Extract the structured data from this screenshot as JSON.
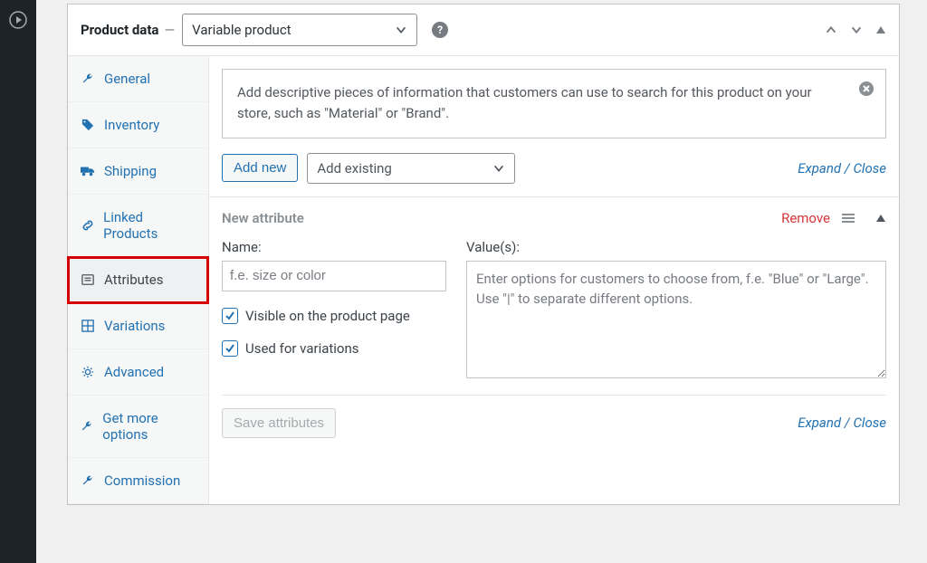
{
  "header": {
    "title": "Product data",
    "type_selected": "Variable product"
  },
  "sidebar": {
    "items": [
      {
        "label": "General"
      },
      {
        "label": "Inventory"
      },
      {
        "label": "Shipping"
      },
      {
        "label": "Linked Products"
      },
      {
        "label": "Attributes"
      },
      {
        "label": "Variations"
      },
      {
        "label": "Advanced"
      },
      {
        "label": "Get more options"
      },
      {
        "label": "Commission"
      }
    ]
  },
  "notice": {
    "text": "Add descriptive pieces of information that customers can use to search for this product on your store, such as \"Material\" or \"Brand\"."
  },
  "toolbar": {
    "add_new": "Add new",
    "add_existing_placeholder": "Add existing",
    "expand_close": "Expand / Close"
  },
  "attribute": {
    "heading": "New attribute",
    "remove": "Remove",
    "name_label": "Name:",
    "name_placeholder": "f.e. size or color",
    "values_label": "Value(s):",
    "values_placeholder": "Enter options for customers to choose from, f.e. \"Blue\" or \"Large\". Use \"|\" to separate different options.",
    "visible_label": "Visible on the product page",
    "used_variations_label": "Used for variations"
  },
  "footer": {
    "save": "Save attributes",
    "expand_close": "Expand / Close"
  }
}
